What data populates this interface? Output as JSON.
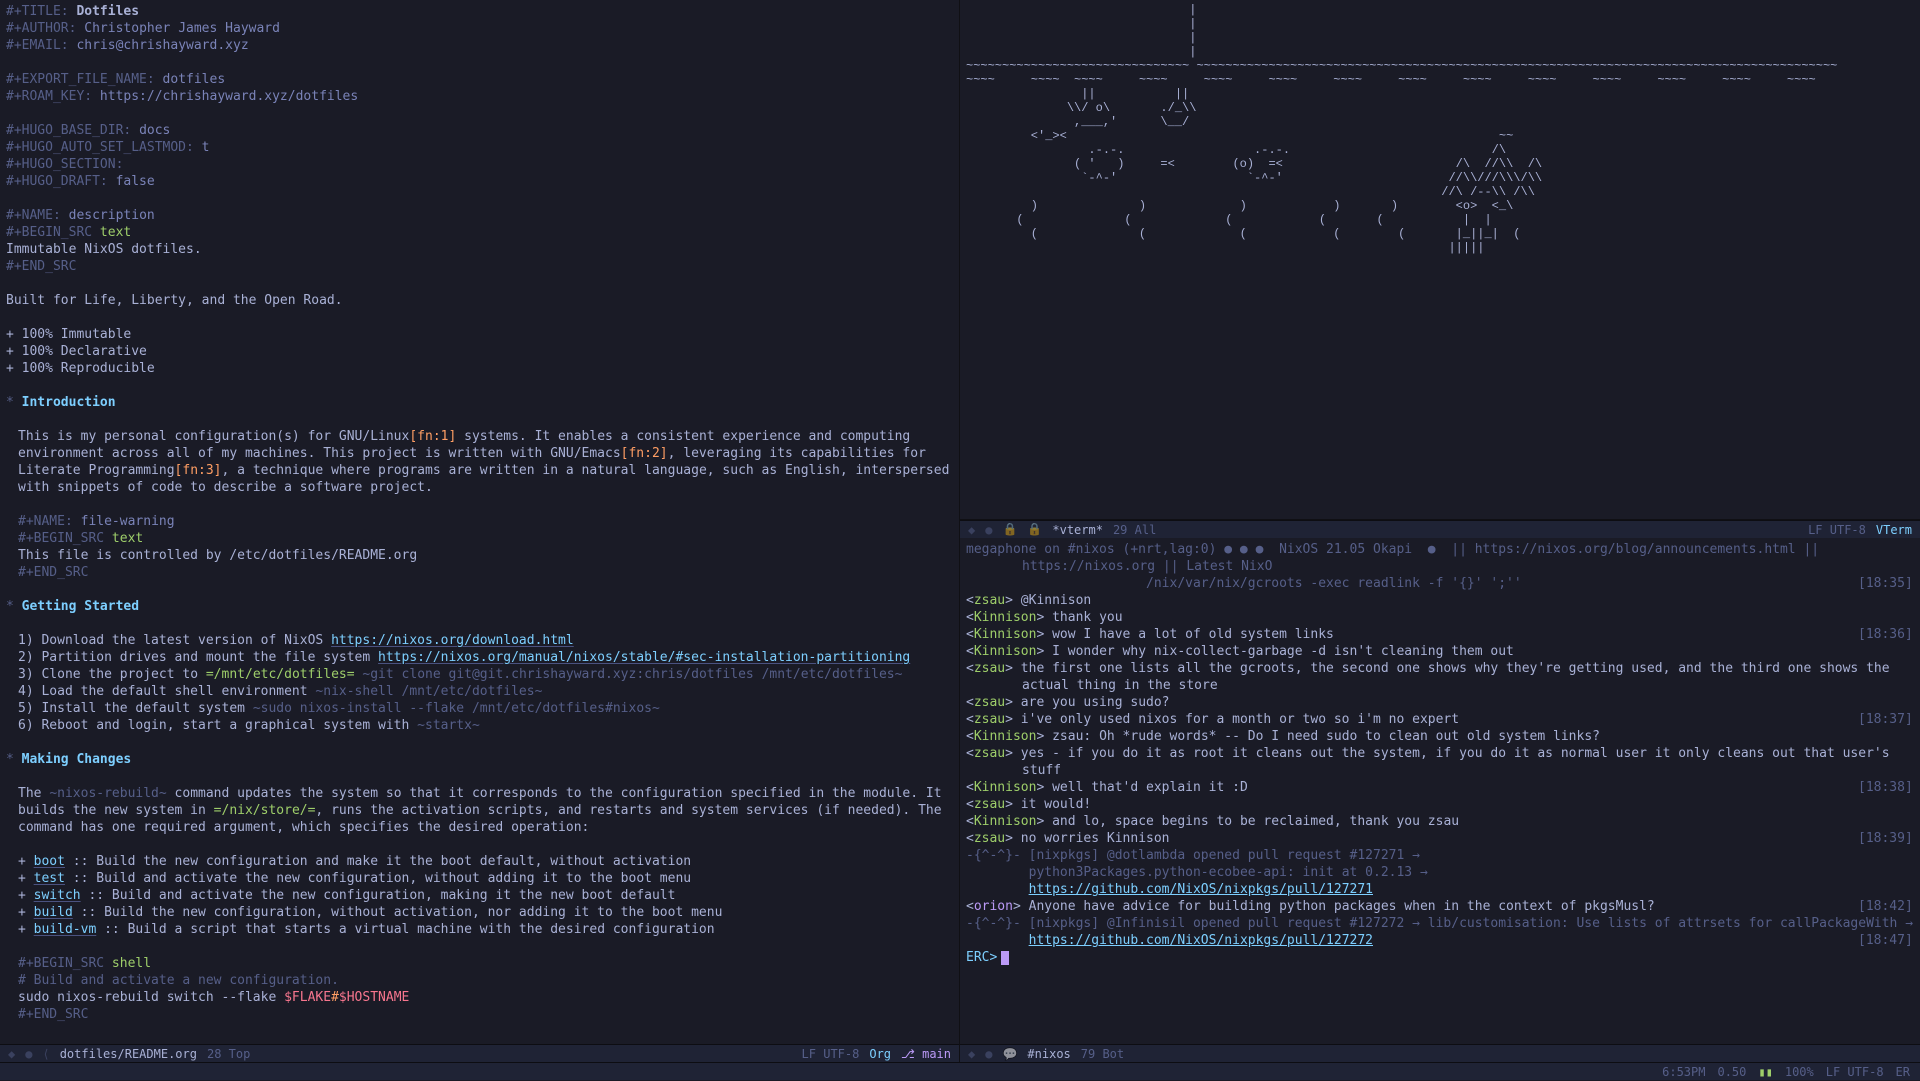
{
  "org": {
    "title_key": "#+TITLE:",
    "title": "Dotfiles",
    "author_key": "#+AUTHOR:",
    "author": "Christopher James Hayward",
    "email_key": "#+EMAIL:",
    "email": "chris@chrishayward.xyz",
    "export_key": "#+EXPORT_FILE_NAME:",
    "export": "dotfiles",
    "roam_key": "#+ROAM_KEY:",
    "roam": "https://chrishayward.xyz/dotfiles",
    "hugo1k": "#+HUGO_BASE_DIR:",
    "hugo1v": "docs",
    "hugo2k": "#+HUGO_AUTO_SET_LASTMOD:",
    "hugo2v": "t",
    "hugo3k": "#+HUGO_SECTION:",
    "hugo4k": "#+HUGO_DRAFT:",
    "hugo4v": "false",
    "name1k": "#+NAME:",
    "name1v": "description",
    "begin1": "#+BEGIN_SRC",
    "lang_text": "text",
    "desc_body": "Immutable NixOS dotfiles.",
    "end1": "#+END_SRC",
    "tagline": "Built for Life, Liberty, and the Open Road.",
    "feat1": "+ 100% Immutable",
    "feat2": "+ 100% Declarative",
    "feat3": "+ 100% Reproducible",
    "h1": "Introduction",
    "intro": "This is my personal configuration(s) for GNU/Linux[fn:1] systems. It enables a consistent experience and computing environment across all of my machines. This project is written with GNU/Emacs[fn:2], leveraging its capabilities for Literate Programming[fn:3], a technique where programs are written in a natural language, such as English, interspersed with snippets of code to describe a software project.",
    "name2v": "file-warning",
    "warn_body": "This file is controlled by /etc/dotfiles/README.org",
    "h2": "Getting Started",
    "gs1a": "Download the latest version of NixOS ",
    "gs1link": "https://nixos.org/download.html",
    "gs2a": "Partition drives and mount the file system ",
    "gs2link": "https://nixos.org/manual/nixos/stable/#sec-installation-partitioning",
    "gs3a": "Clone the project to ",
    "gs3p": "=/mnt/etc/dotfiles=",
    "gs3b": " ~git clone git@git.chrishayward.xyz:chris/dotfiles /mnt/etc/dotfiles~",
    "gs4": "Load the default shell environment ~nix-shell /mnt/etc/dotfiles~",
    "gs5": "Install the default system ~sudo nixos-install --flake /mnt/etc/dotfiles#nixos~",
    "gs6": "Reboot and login, start a graphical system with ~startx~",
    "h3": "Making Changes",
    "mc_para": "The ~nixos-rebuild~ command updates the system so that it corresponds to the configuration specified in the module. It builds the new system in =/nix/store/=, runs the activation scripts, and restarts and system services (if needed). The command has one required argument, which specifies the desired operation:",
    "mc_boot": "boot :: Build the new configuration and make it the boot default, without activation",
    "mc_test": "test :: Build and activate the new configuration, without adding it to the boot menu",
    "mc_switch": "switch :: Build and activate the new configuration, making it the new boot default",
    "mc_build": "build :: Build the new configuration, without activation, nor adding it to the boot menu",
    "mc_vm": "build-vm :: Build a script that starts a virtual machine with the desired configuration",
    "lang_shell": "shell",
    "mc_comment": "# Build and activate a new configuration.",
    "mc_cmd_pre": "sudo nixos-rebuild switch --flake ",
    "mc_var1": "$FLAKE",
    "mc_hash": "#",
    "mc_var2": "$HOSTNAME"
  },
  "vterm": {
    "ascii": "                               |\n                               |\n                               |\n                               |\n~~~~~~~~~~~~~~~~~~~~~~~~~~~~~~~ ~~~~~~~~~~~~~~~~~~~~~~~~~~~~~~~~~~~~~~~~~~~~~~~~~~~~~~~~~~~~~~~~~~~~~~~~~~~~~~~~~~~~~~~~~\n~~~~     ~~~~  ~~~~     ~~~~     ~~~~     ~~~~     ~~~~     ~~~~     ~~~~     ~~~~     ~~~~     ~~~~     ~~~~     ~~~~\n                ||           ||\n              \\\\/ o\\       ./_\\\\\n               ,___,'      \\__/\n         <'_><                                                            ~~\n                 .-.-.                  .-.-.                            /\\\n               ( '   )     =<        (o)  =<                        /\\  //\\\\  /\\\n                `-^-'                  `-^-'                       //\\\\///\\\\\\/\\\\\n                                                                  //\\ /--\\\\ /\\\\\n         )              )             )            )       )        <o>  <_\\\n       (              (             (            (       (           |  |\n         (              (             (            (        (       |_||_|  (\n                                                                   |||||   "
  },
  "erc": {
    "serv1": "megaphone on #nixos (+nrt,lag:0) ● ● ●  NixOS 21.05 Okapi  ●  || https://nixos.org/blog/announcements.html || https://nixos.org || Latest NixO",
    "serv2": "                       /nix/var/nix/gcroots -exec readlink -f '{}' ';''",
    "serv2_ts": "[18:35]",
    "lines": [
      {
        "nick": "zsau",
        "c": "nick",
        "msg": "@Kinnison"
      },
      {
        "nick": "Kinnison",
        "c": "nick",
        "msg": "thank you"
      },
      {
        "nick": "Kinnison",
        "c": "nick",
        "msg": "wow I have a lot of old system links",
        "ts": "[18:36]"
      },
      {
        "nick": "Kinnison",
        "c": "nick",
        "msg": "I wonder why nix-collect-garbage -d isn't cleaning them out"
      },
      {
        "nick": "zsau",
        "c": "nick",
        "msg": "the first one lists all the gcroots, the second one shows why they're getting used, and the third one shows the actual thing in the store"
      },
      {
        "nick": "zsau",
        "c": "nick",
        "msg": "are you using sudo?"
      },
      {
        "nick": "zsau",
        "c": "nick",
        "msg": "i've only used nixos for a month or two so i'm no expert",
        "ts": "[18:37]"
      },
      {
        "nick": "Kinnison",
        "c": "nick",
        "msg": "zsau: Oh *rude words* -- Do I need sudo to clean out old system links?"
      },
      {
        "nick": "zsau",
        "c": "nick",
        "msg": "yes - if you do it as root it cleans out the system, if you do it as normal user it only cleans out that user's stuff"
      },
      {
        "nick": "Kinnison",
        "c": "nick",
        "msg": "well that'd explain it :D",
        "ts": "[18:38]"
      },
      {
        "nick": "zsau",
        "c": "nick",
        "msg": "it would!"
      },
      {
        "nick": "Kinnison",
        "c": "nick",
        "msg": "and lo, space begins to be reclaimed, thank you zsau"
      },
      {
        "nick": "zsau",
        "c": "nick",
        "msg": "no worries Kinnison",
        "ts": "[18:39]"
      }
    ],
    "pr1a": "-{^-^}- [nixpkgs] @dotlambda opened pull request #127271 →",
    "pr1b": "        python3Packages.python-ecobee-api: init at 0.2.13 →",
    "pr1link": "https://github.com/NixOS/nixpkgs/pull/127271",
    "orion_nick": "orion",
    "orion_msg": "Anyone have advice for building python packages when in the context of pkgsMusl?",
    "orion_ts": "[18:42]",
    "pr2a": "-{^-^}- [nixpkgs] @Infinisil opened pull request #127272 → lib/customisation: Use lists of attrsets for callPackageWith →",
    "pr2link": "https://github.com/NixOS/nixpkgs/pull/127272",
    "pr2_ts": "[18:47]",
    "prompt": "ERC>"
  },
  "modelines": {
    "org": {
      "buf": "dotfiles/README.org",
      "pos": "28 Top",
      "enc": "LF UTF-8",
      "mode": "Org",
      "branch": "main"
    },
    "vterm": {
      "buf": "*vterm*",
      "pos": "29 All",
      "enc": "LF UTF-8",
      "mode": "VTerm"
    },
    "erc": {
      "buf": "#nixos",
      "pos": "79 Bot"
    }
  },
  "tabbar": {
    "time": "6:53PM",
    "load": "0.50",
    "batt": "100%",
    "enc": "LF UTF-8",
    "mode": "ER"
  },
  "branch_icon": "⎇"
}
